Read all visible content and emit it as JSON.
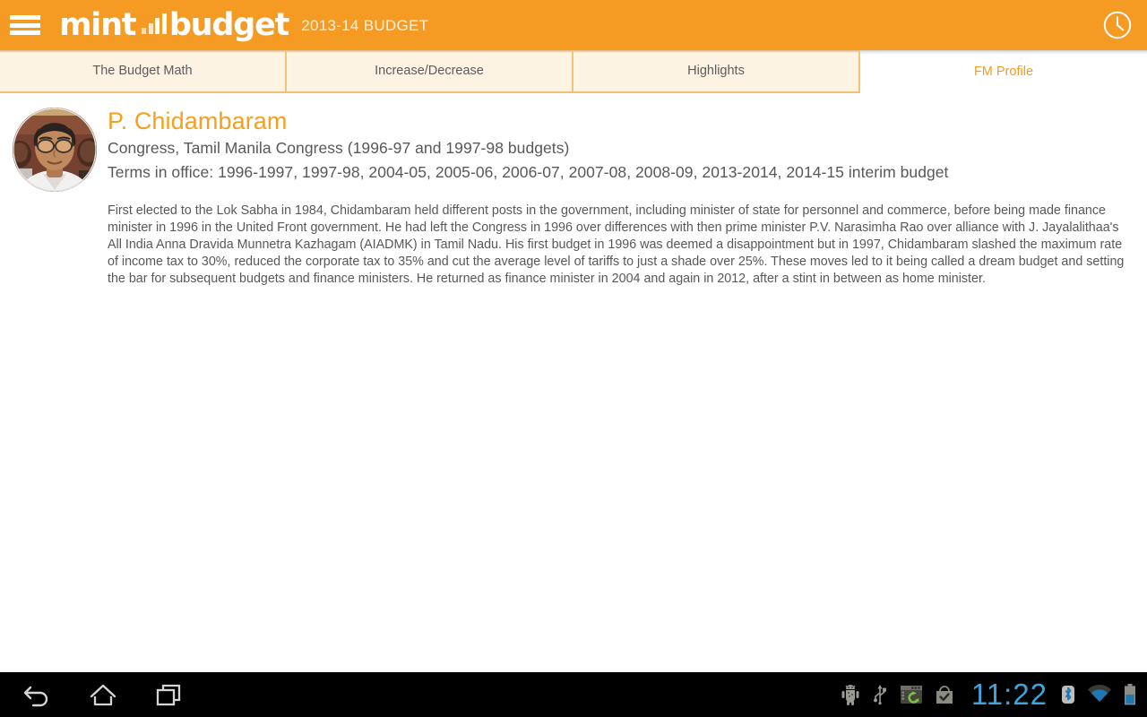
{
  "header": {
    "menu_icon": "hamburger-menu-icon",
    "brand_primary": "mint",
    "brand_secondary": "budget",
    "brand_bars_icon": "bar-chart-icon",
    "subtitle": "2013-14 BUDGET",
    "clock_icon": "clock-icon",
    "background_color": "#f59a23"
  },
  "tabs": [
    {
      "label": "The Budget Math",
      "active": false
    },
    {
      "label": "Increase/Decrease",
      "active": false
    },
    {
      "label": "Highlights",
      "active": false
    },
    {
      "label": "FM Profile",
      "active": true
    }
  ],
  "profile": {
    "avatar_icon": "fm-portrait-avatar",
    "name": "P. Chidambaram",
    "party": "Congress, Tamil Manila Congress (1996-97 and 1997-98 budgets)",
    "terms": "Terms in office: 1996-1997, 1997-98, 2004-05, 2005-06, 2006-07, 2007-08, 2008-09, 2013-2014, 2014-15 interim budget",
    "bio": "First elected to the Lok Sabha in 1984, Chidambaram held different posts in the government, including minister of state for personnel and commerce, before being made finance minister in 1996 in the United Front government. He had left the Congress in 1996 over differences with then prime minister P.V. Narasimha Rao over alliance with J. Jayalalithaa's All India Anna Dravida Munnetra Kazhagam (AIADMK) in Tamil Nadu. His first budget in 1996 was deemed a disappointment but in 1997, Chidambaram slashed the maximum rate of income tax to 30%, reduced the corporate tax to 35% and cut the average level of tariffs to just a shade over 25%. These moves led to it being called a dream budget and setting the bar for subsequent budgets and finance ministers. He returned as finance minister in 2004 and again in 2012, after a stint in between as home minister.",
    "name_color": "#f5a020",
    "text_color": "#58585a"
  },
  "navbar": {
    "back_icon": "back-arrow-icon",
    "home_icon": "home-icon",
    "recents_icon": "recent-apps-icon",
    "status_icons": [
      "android-debug-icon",
      "usb-icon",
      "software-update-icon",
      "play-store-checkmark-icon"
    ],
    "clock": "11:22",
    "bluetooth_icon": "bluetooth-icon",
    "wifi_icon": "wifi-icon",
    "battery_icon": "battery-icon",
    "clock_color": "#3ca5de"
  }
}
